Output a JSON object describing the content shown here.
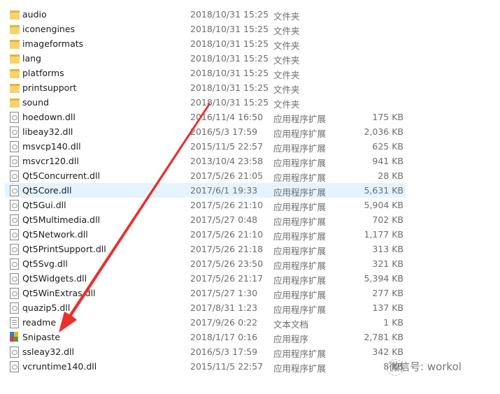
{
  "files": [
    {
      "name": "audio",
      "date": "2018/10/31 15:25",
      "type": "文件夹",
      "size": "",
      "icon": "folder-icon"
    },
    {
      "name": "iconengines",
      "date": "2018/10/31 15:25",
      "type": "文件夹",
      "size": "",
      "icon": "folder-icon"
    },
    {
      "name": "imageformats",
      "date": "2018/10/31 15:25",
      "type": "文件夹",
      "size": "",
      "icon": "folder-icon"
    },
    {
      "name": "lang",
      "date": "2018/10/31 15:25",
      "type": "文件夹",
      "size": "",
      "icon": "folder-icon"
    },
    {
      "name": "platforms",
      "date": "2018/10/31 15:25",
      "type": "文件夹",
      "size": "",
      "icon": "folder-icon"
    },
    {
      "name": "printsupport",
      "date": "2018/10/31 15:25",
      "type": "文件夹",
      "size": "",
      "icon": "folder-icon"
    },
    {
      "name": "sound",
      "date": "2018/10/31 15:25",
      "type": "文件夹",
      "size": "",
      "icon": "folder-icon"
    },
    {
      "name": "hoedown.dll",
      "date": "2016/11/4 16:50",
      "type": "应用程序扩展",
      "size": "175 KB",
      "icon": "dll-icon"
    },
    {
      "name": "libeay32.dll",
      "date": "2016/5/3 17:59",
      "type": "应用程序扩展",
      "size": "2,036 KB",
      "icon": "dll-icon"
    },
    {
      "name": "msvcp140.dll",
      "date": "2015/11/5 22:57",
      "type": "应用程序扩展",
      "size": "625 KB",
      "icon": "dll-icon"
    },
    {
      "name": "msvcr120.dll",
      "date": "2013/10/4 23:58",
      "type": "应用程序扩展",
      "size": "941 KB",
      "icon": "dll-icon"
    },
    {
      "name": "Qt5Concurrent.dll",
      "date": "2017/5/26 21:05",
      "type": "应用程序扩展",
      "size": "28 KB",
      "icon": "dll-icon"
    },
    {
      "name": "Qt5Core.dll",
      "date": "2017/6/1 19:33",
      "type": "应用程序扩展",
      "size": "5,631 KB",
      "icon": "dll-icon",
      "selected": true
    },
    {
      "name": "Qt5Gui.dll",
      "date": "2017/5/26 21:10",
      "type": "应用程序扩展",
      "size": "5,904 KB",
      "icon": "dll-icon"
    },
    {
      "name": "Qt5Multimedia.dll",
      "date": "2017/5/27 0:48",
      "type": "应用程序扩展",
      "size": "702 KB",
      "icon": "dll-icon"
    },
    {
      "name": "Qt5Network.dll",
      "date": "2017/5/26 21:10",
      "type": "应用程序扩展",
      "size": "1,177 KB",
      "icon": "dll-icon"
    },
    {
      "name": "Qt5PrintSupport.dll",
      "date": "2017/5/26 21:18",
      "type": "应用程序扩展",
      "size": "313 KB",
      "icon": "dll-icon"
    },
    {
      "name": "Qt5Svg.dll",
      "date": "2017/5/26 23:50",
      "type": "应用程序扩展",
      "size": "321 KB",
      "icon": "dll-icon"
    },
    {
      "name": "Qt5Widgets.dll",
      "date": "2017/5/26 21:17",
      "type": "应用程序扩展",
      "size": "5,394 KB",
      "icon": "dll-icon"
    },
    {
      "name": "Qt5WinExtras.dll",
      "date": "2017/5/27 1:30",
      "type": "应用程序扩展",
      "size": "277 KB",
      "icon": "dll-icon"
    },
    {
      "name": "quazip5.dll",
      "date": "2017/8/31 1:23",
      "type": "应用程序扩展",
      "size": "137 KB",
      "icon": "dll-icon"
    },
    {
      "name": "readme",
      "date": "2017/9/26 0:22",
      "type": "文本文档",
      "size": "1 KB",
      "icon": "text-file-icon"
    },
    {
      "name": "Snipaste",
      "date": "2018/1/17 0:16",
      "type": "应用程序",
      "size": "2,781 KB",
      "icon": "snipaste-icon"
    },
    {
      "name": "ssleay32.dll",
      "date": "2016/5/3 17:59",
      "type": "应用程序扩展",
      "size": "342 KB",
      "icon": "dll-icon"
    },
    {
      "name": "vcruntime140.dll",
      "date": "2015/11/5 22:57",
      "type": "应用程序扩展",
      "size": "8 KB",
      "icon": "dll-icon"
    }
  ],
  "watermark": "微信号: workol",
  "colors": {
    "selection": "#e5f3ff",
    "arrow": "#e8302f",
    "folder": "#f7d36b"
  }
}
